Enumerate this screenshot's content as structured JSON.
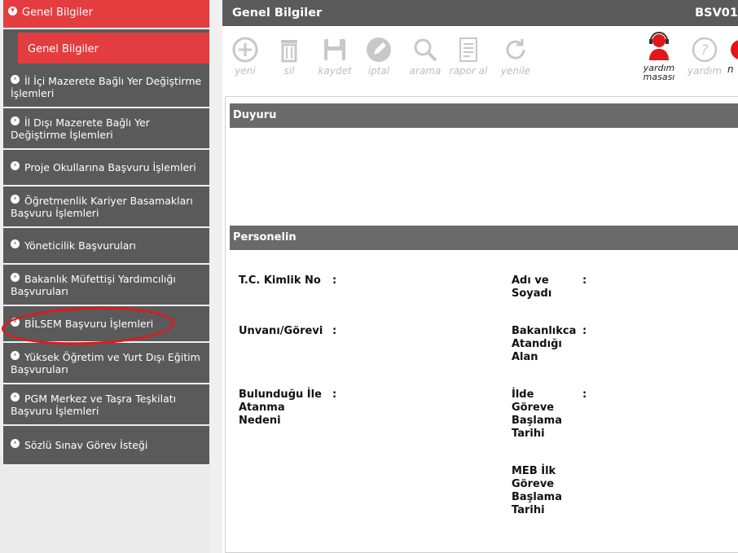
{
  "sidebar": {
    "header": "Genel Bilgiler",
    "active_sub": "Genel Bilgiler",
    "items": [
      {
        "l1": "İl İçi Mazerete Bağlı Yer Değiştirme",
        "l2": "İşlemleri"
      },
      {
        "l1": "İl Dışı Mazerete Bağlı Yer",
        "l2": "Değiştirme İşlemleri"
      },
      {
        "l1": "Proje Okullarına Başvuru İşlemleri",
        "l2": ""
      },
      {
        "l1": "Öğretmenlik Kariyer Basamakları",
        "l2": "Başvuru İşlemleri"
      },
      {
        "l1": "Yöneticilik Başvuruları",
        "l2": ""
      },
      {
        "l1": "Bakanlık Müfettişi Yardımcılığı",
        "l2": "Başvuruları"
      },
      {
        "l1": "BİLSEM Başvuru İşlemleri",
        "l2": ""
      },
      {
        "l1": "Yüksek Öğretim ve Yurt Dışı Eğitim",
        "l2": "Başvuruları"
      },
      {
        "l1": "PGM Merkez ve Taşra Teşkilatı",
        "l2": "Başvuru İşlemleri"
      },
      {
        "l1": "Sözlü Sınav Görev İsteği",
        "l2": ""
      }
    ]
  },
  "header": {
    "title": "Genel Bilgiler",
    "code": "BSV01"
  },
  "toolbar": {
    "new": "yeni",
    "delete": "sil",
    "save": "kaydet",
    "cancel": "iptal",
    "search": "arama",
    "report": "rapor al",
    "refresh": "yenile",
    "helpdesk_l1": "yardım",
    "helpdesk_l2": "masası",
    "help": "yardım",
    "extra": "n"
  },
  "sections": {
    "announcement": "Duyuru",
    "personnel": "Personelin"
  },
  "fields": {
    "tc": "T.C. Kimlik No",
    "name_l1": "Adı ve",
    "name_l2": "Soyadı",
    "title": "Unvanı/Görevi",
    "ministry_l1": "Bakanlıkca",
    "ministry_l2": "Atandığı",
    "ministry_l3": "Alan",
    "reason_l1": "Bulunduğu İle",
    "reason_l2": "Atanma",
    "reason_l3": "Nedeni",
    "start_l1": "İlde",
    "start_l2": "Göreve",
    "start_l3": "Başlama",
    "start_l4": "Tarihi",
    "meb_l1": "MEB İlk",
    "meb_l2": "Göreve",
    "meb_l3": "Başlama",
    "meb_l4": "Tarihi",
    "colon": ":"
  },
  "colors": {
    "accent": "#e43d3f",
    "menu_bg": "#5a5a5a",
    "annotation": "#e3171b"
  }
}
